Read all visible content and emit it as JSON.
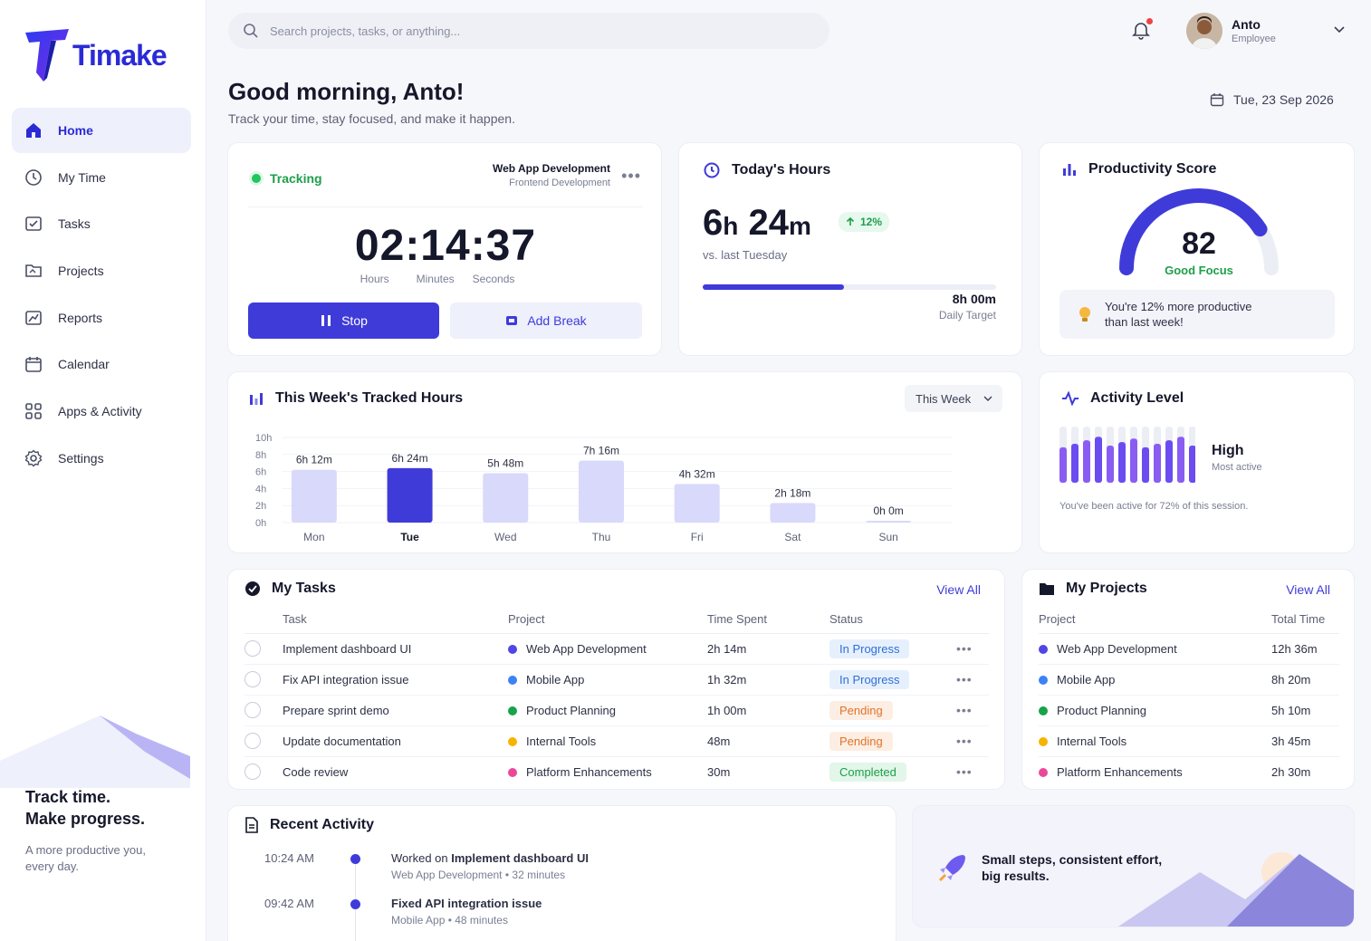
{
  "app": {
    "name": "Timake"
  },
  "nav": [
    {
      "label": "Home",
      "icon": "home-icon",
      "active": true
    },
    {
      "label": "My Time",
      "icon": "clock-icon"
    },
    {
      "label": "Tasks",
      "icon": "tasks-icon"
    },
    {
      "label": "Projects",
      "icon": "folder-icon"
    },
    {
      "label": "Reports",
      "icon": "reports-icon"
    },
    {
      "label": "Calendar",
      "icon": "calendar-icon"
    },
    {
      "label": "Apps & Activity",
      "icon": "apps-icon"
    },
    {
      "label": "Settings",
      "icon": "gear-icon"
    }
  ],
  "sidebar_promo": {
    "line1": "Track time.",
    "line2": "Make progress.",
    "sub": "A more productive you, every day."
  },
  "search": {
    "placeholder": "Search projects, tasks, or anything..."
  },
  "user": {
    "name": "Anto",
    "role": "Employee"
  },
  "greeting": {
    "title": "Good morning, Anto!",
    "subtitle": "Track your time, stay focused, and make it happen.",
    "date": "Tue, 23 Sep 2026"
  },
  "tracker": {
    "status": "Tracking",
    "project": "Web App Development",
    "subproject": "Frontend Development",
    "time": "02:14:37",
    "labels": {
      "hours": "Hours",
      "minutes": "Minutes",
      "seconds": "Seconds"
    },
    "stop_label": "Stop",
    "break_label": "Add Break"
  },
  "today": {
    "title": "Today's Hours",
    "hours_num": "6",
    "hours_unit": "h",
    "mins_num": "24",
    "mins_unit": "m",
    "change": "12%",
    "compare": "vs. last Tuesday",
    "progress_fraction": 0.48,
    "target": "8h 00m",
    "target_label": "Daily Target"
  },
  "productivity": {
    "title": "Productivity Score",
    "score": "82",
    "score_value": 82,
    "label": "Good Focus",
    "note": "You're 12% more productive than last week!"
  },
  "week": {
    "title": "This Week's Tracked Hours",
    "filter": "This Week"
  },
  "chart_data": {
    "type": "bar",
    "title": "This Week's Tracked Hours",
    "categories": [
      "Mon",
      "Tue",
      "Wed",
      "Thu",
      "Fri",
      "Sat",
      "Sun"
    ],
    "values": [
      6.2,
      6.4,
      5.8,
      7.27,
      4.53,
      2.3,
      0
    ],
    "value_labels": [
      "6h 12m",
      "6h 24m",
      "5h 48m",
      "7h 16m",
      "4h 32m",
      "2h 18m",
      "0h 0m"
    ],
    "y_ticks": [
      "0h",
      "2h",
      "4h",
      "6h",
      "8h",
      "10h"
    ],
    "ylim": [
      0,
      10
    ],
    "highlight": "Tue",
    "colors": {
      "bar": "#d9d9fb",
      "highlight": "#3f3bd9"
    }
  },
  "activity": {
    "title": "Activity Level",
    "level": "High",
    "level_sub": "Most active",
    "summary": "You've been active for 72% of this session.",
    "bars_fraction": [
      0.72,
      0.72,
      0.72,
      0.72,
      0.72,
      0.72,
      0.72,
      0.72,
      0.72,
      0.72,
      0.72,
      0.72
    ]
  },
  "tasks": {
    "title": "My Tasks",
    "view_all": "View All",
    "headers": [
      "Task",
      "Project",
      "Time Spent",
      "Status"
    ],
    "rows": [
      {
        "task": "Implement dashboard UI",
        "project": "Web App Development",
        "color": "#4f46e5",
        "time": "2h 14m",
        "status": "In Progress",
        "kind": "progress"
      },
      {
        "task": "Fix API integration issue",
        "project": "Mobile App",
        "color": "#3b82f6",
        "time": "1h 32m",
        "status": "In Progress",
        "kind": "progress"
      },
      {
        "task": "Prepare sprint demo",
        "project": "Product Planning",
        "color": "#16a34a",
        "time": "1h 00m",
        "status": "Pending",
        "kind": "pending"
      },
      {
        "task": "Update documentation",
        "project": "Internal Tools",
        "color": "#f5b400",
        "time": "48m",
        "status": "Pending",
        "kind": "pending"
      },
      {
        "task": "Code review",
        "project": "Platform Enhancements",
        "color": "#ec4899",
        "time": "30m",
        "status": "Completed",
        "kind": "completed"
      }
    ]
  },
  "projects": {
    "title": "My Projects",
    "view_all": "View All",
    "headers": [
      "Project",
      "Total Time"
    ],
    "rows": [
      {
        "project": "Web App Development",
        "color": "#4f46e5",
        "time": "12h 36m"
      },
      {
        "project": "Mobile App",
        "color": "#3b82f6",
        "time": "8h 20m"
      },
      {
        "project": "Product Planning",
        "color": "#16a34a",
        "time": "5h 10m"
      },
      {
        "project": "Internal Tools",
        "color": "#f5b400",
        "time": "3h 45m"
      },
      {
        "project": "Platform Enhancements",
        "color": "#ec4899",
        "time": "2h 30m"
      }
    ]
  },
  "recent": {
    "title": "Recent Activity",
    "items": [
      {
        "time": "10:24 AM",
        "prefix": "Worked on",
        "task": "Implement dashboard UI",
        "meta": "Web App Development • 32 minutes"
      },
      {
        "time": "09:42 AM",
        "prefix": "",
        "task": "Fixed API integration issue",
        "meta": "Mobile App • 48 minutes"
      }
    ]
  },
  "motivation": {
    "line1": "Small steps, consistent effort,",
    "line2": "big results."
  }
}
